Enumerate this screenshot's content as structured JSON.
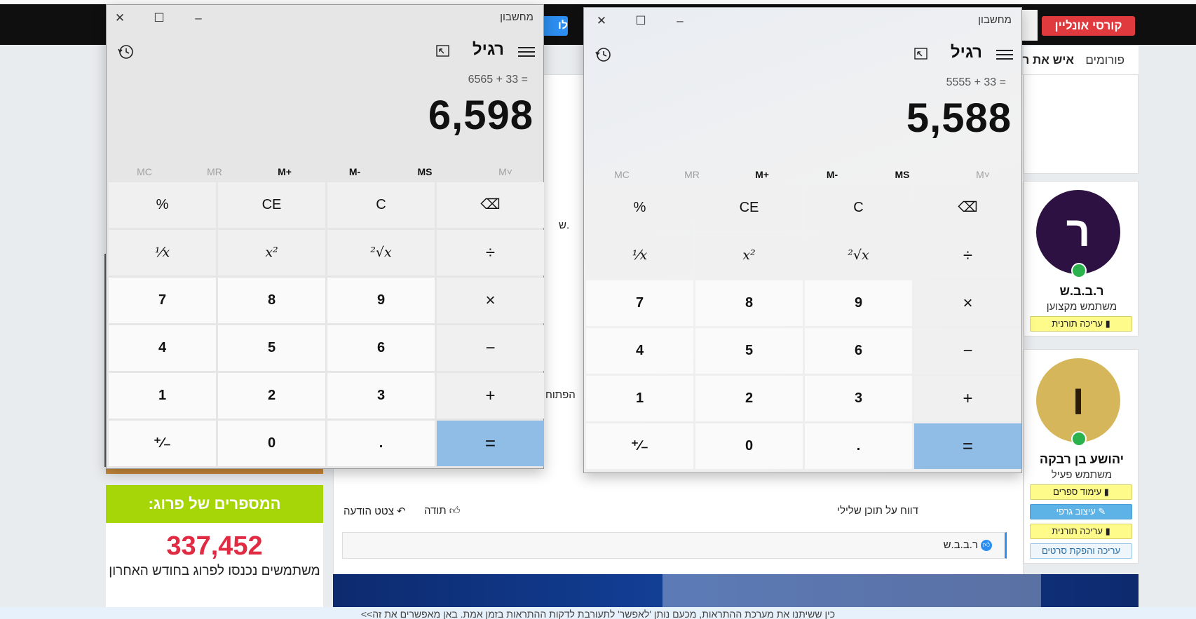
{
  "site": {
    "online_courses_button": "קורסי אונליין",
    "blue_button": "לו",
    "nav": {
      "forums": "פורומים",
      "person": "איש את רע"
    },
    "users": [
      {
        "avatar_letter": "ר",
        "avatar_color": "#2d1142",
        "name": "ר.ב.ב.ש",
        "rank": "משתמש מקצוען",
        "badges": [
          "עריכה תורנית"
        ]
      },
      {
        "avatar_letter": "ו",
        "avatar_color": "#d6b65a",
        "name": "יהושע בן רבקה",
        "rank": "משתמש פעיל",
        "badges": [
          "עימוד ספרים",
          "עיצוב גרפי",
          "עריכה תורנית",
          "עריכה והפקת סרטים"
        ]
      }
    ],
    "post": {
      "report": "דווח על תוכן שלילי",
      "thanks": "תודה",
      "quote": "צטט הודעה",
      "liker": "ר.ב.ב.ש",
      "frag_open": "הפתוח",
      "frag_sh": "ש."
    },
    "stats": {
      "title": "המספרים של פרוג:",
      "number": "337,452",
      "text": "משתמשים נכנסו לפרוג בחודש האחרון"
    },
    "bottom_notice": "כין ששיתנו את מערכת ההתראות, מכעם נותן 'לאפשר' לתעורבת לדקות ההתראות בזמן אמת. באן מאפשרים את זה>>"
  },
  "calculators": [
    {
      "title": "מחשבון",
      "mode": "רגיל",
      "expression": "6565 + 33 =",
      "result": "6,598"
    },
    {
      "title": "מחשבון",
      "mode": "רגיל",
      "expression": "5555 + 33 =",
      "result": "5,588"
    }
  ],
  "memory_keys": [
    "MC",
    "MR",
    "M+",
    "M-",
    "MS",
    "M˅"
  ],
  "keypad": {
    "percent": "%",
    "ce": "CE",
    "c": "C",
    "backspace": "⌫",
    "reciprocal": "⅟x",
    "square": "x²",
    "sqrt": "²√x",
    "divide": "÷",
    "seven": "7",
    "eight": "8",
    "nine": "9",
    "multiply": "×",
    "four": "4",
    "five": "5",
    "six": "6",
    "minus": "−",
    "one": "1",
    "two": "2",
    "three": "3",
    "plus": "+",
    "negate": "⁺∕₋",
    "zero": "0",
    "decimal": ".",
    "equals": "="
  },
  "colors": {
    "accent_red": "#e03a3e",
    "equals_key": "#8fbde6",
    "stats_green": "#a6d608",
    "stats_number": "#e02b43"
  }
}
